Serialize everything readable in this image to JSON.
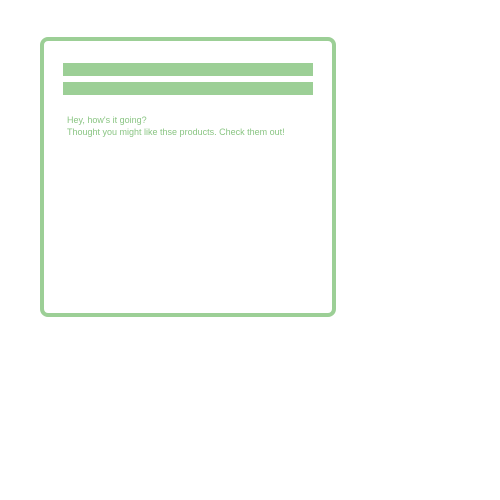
{
  "email_card": {
    "greeting": "Hey, how's it going?",
    "body_line": "Thought you might like thse products. Check them out!"
  },
  "colors": {
    "accent": "#9ccf96",
    "text": "#8ac583",
    "background": "#ffffff"
  }
}
